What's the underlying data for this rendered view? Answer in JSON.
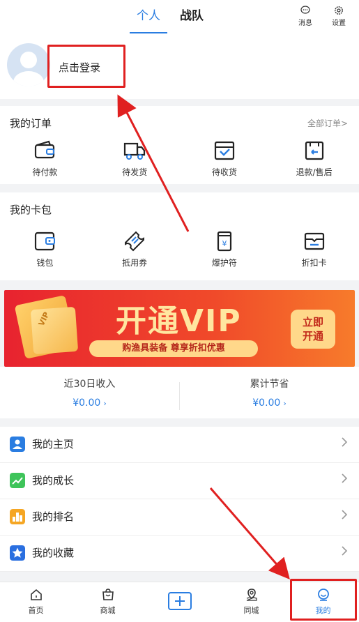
{
  "header": {
    "tabs": [
      {
        "label": "个人",
        "active": true
      },
      {
        "label": "战队",
        "active": false
      }
    ],
    "actions": [
      {
        "label": "消息",
        "icon": "message-icon"
      },
      {
        "label": "设置",
        "icon": "settings-icon"
      }
    ]
  },
  "profile": {
    "login_text": "点击登录"
  },
  "orders": {
    "title": "我的订单",
    "link": "全部订单>",
    "items": [
      {
        "label": "待付款",
        "icon": "wallet-icon"
      },
      {
        "label": "待发货",
        "icon": "truck-icon"
      },
      {
        "label": "待收货",
        "icon": "box-check-icon"
      },
      {
        "label": "退款/售后",
        "icon": "return-icon"
      }
    ]
  },
  "cards": {
    "title": "我的卡包",
    "items": [
      {
        "label": "钱包",
        "icon": "wallet-icon"
      },
      {
        "label": "抵用券",
        "icon": "ticket-icon"
      },
      {
        "label": "爆护符",
        "icon": "charm-icon"
      },
      {
        "label": "折扣卡",
        "icon": "discount-card-icon"
      }
    ]
  },
  "vip_banner": {
    "title": "开通VIP",
    "subtitle": "购渔具装备  尊享折扣优惠",
    "button_line1": "立即",
    "button_line2": "开通",
    "card_text": "VIP"
  },
  "income": {
    "left_label": "近30日收入",
    "left_value": "¥0.00",
    "right_label": "累计节省",
    "right_value": "¥0.00"
  },
  "menu": [
    {
      "label": "我的主页",
      "icon": "user-icon",
      "color": "#2a7de1"
    },
    {
      "label": "我的成长",
      "icon": "growth-icon",
      "color": "#3ec45a"
    },
    {
      "label": "我的排名",
      "icon": "ranking-icon",
      "color": "#f5a623"
    },
    {
      "label": "我的收藏",
      "icon": "star-icon",
      "color": "#2a6fe0"
    }
  ],
  "bottom_nav": [
    {
      "label": "首页",
      "icon": "home-icon",
      "active": false
    },
    {
      "label": "商城",
      "icon": "shop-icon",
      "active": false
    },
    {
      "label": "",
      "icon": "plus-icon",
      "active": false
    },
    {
      "label": "同城",
      "icon": "location-icon",
      "active": false
    },
    {
      "label": "我的",
      "icon": "profile-icon",
      "active": true
    }
  ],
  "colors": {
    "accent": "#2a7de1",
    "annotation": "#e02020"
  }
}
